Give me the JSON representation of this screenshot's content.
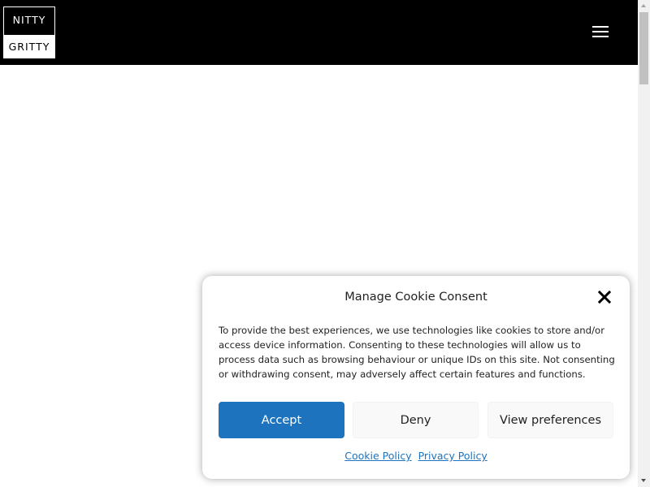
{
  "header": {
    "logo": {
      "line1": "NITTY",
      "line2": "GRITTY"
    },
    "menu_icon": "hamburger-menu-icon",
    "background_color": "#000000"
  },
  "cookie_consent": {
    "title": "Manage Cookie Consent",
    "close_icon": "close-icon",
    "body": "To provide the best experiences, we use technologies like cookies to store and/or access device information. Consenting to these technologies will allow us to process data such as browsing behaviour or unique IDs on this site. Not consenting or withdrawing consent, may adversely affect certain features and functions.",
    "buttons": {
      "accept": "Accept",
      "deny": "Deny",
      "view_preferences": "View preferences"
    },
    "links": {
      "cookie_policy": "Cookie Policy",
      "privacy_policy": "Privacy Policy"
    },
    "accent_color": "#1e73be"
  }
}
